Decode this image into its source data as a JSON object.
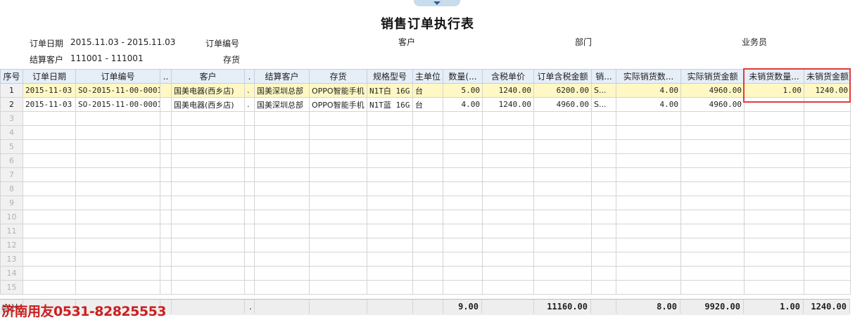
{
  "title": "销售订单执行表",
  "filters": {
    "order_date_label": "订单日期",
    "order_date_value": "2015.11.03 - 2015.11.03",
    "order_no_label": "订单编号",
    "customer_label": "客户",
    "dept_label": "部门",
    "salesman_label": "业务员",
    "settle_customer_label": "结算客户",
    "settle_customer_value": "111001 - 111001",
    "inventory_label": "存货"
  },
  "columns": [
    "序号",
    "订单日期",
    "订单编号",
    "..",
    "客户",
    ".",
    "结算客户",
    "存货",
    "规格型号",
    "主单位",
    "数量(...",
    "含税单价",
    "订单含税金额",
    "销...",
    "实际销货数...",
    "实际销货金额",
    "未销货数量...",
    "未销货金额"
  ],
  "rows": [
    [
      "1",
      "2015-11-03",
      "SO-2015-11-00-0001",
      "",
      "国美电器(西乡店)",
      ".",
      "国美深圳总部",
      "OPPO智能手机",
      "N1T白 16G",
      "台",
      "5.00",
      "1240.00",
      "6200.00",
      "S...",
      "4.00",
      "4960.00",
      "1.00",
      "1240.00"
    ],
    [
      "2",
      "2015-11-03",
      "SO-2015-11-00-0001",
      "",
      "国美电器(西乡店)",
      ".",
      "国美深圳总部",
      "OPPO智能手机",
      "N1T蓝 16G",
      "台",
      "4.00",
      "1240.00",
      "4960.00",
      "S...",
      "4.00",
      "4960.00",
      "",
      ""
    ]
  ],
  "empty_row_numbers": [
    "3",
    "4",
    "5",
    "6",
    "7",
    "8",
    "9",
    "10",
    "11",
    "12",
    "13",
    "14",
    "15"
  ],
  "totals": {
    "label": "合计",
    "dot": ".",
    "quantity": "9.00",
    "order_amount": "11160.00",
    "actual_qty": "8.00",
    "actual_amount": "9920.00",
    "unsold_qty": "1.00",
    "unsold_amount": "1240.00"
  },
  "watermark": "济南用友0531-82825553",
  "colors": {
    "header_bg": "#e6eef8",
    "selected_row": "#fff8c4",
    "highlight_box": "#e23b3b",
    "watermark": "#cc1f1f"
  }
}
